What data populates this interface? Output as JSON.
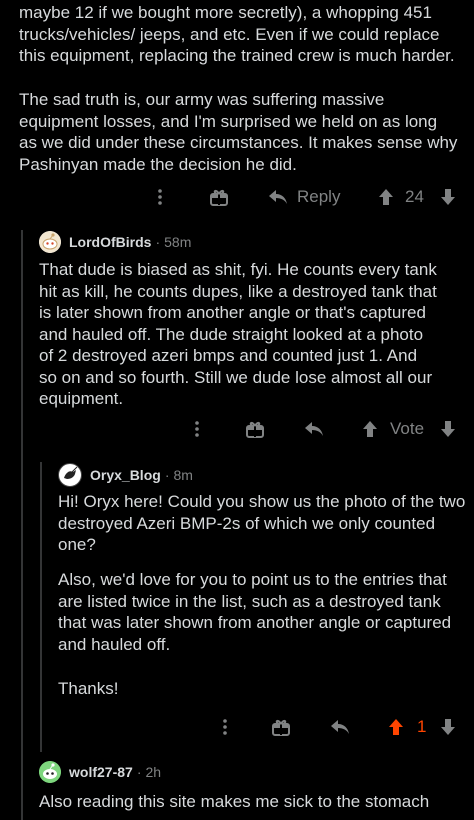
{
  "comments": [
    {
      "body_p1": "maybe 12 if we bought more secretly), a whopping 451\ntrucks/vehicles/ jeeps, and etc. Even if we could replace\nthis equipment, replacing the trained crew is much harder.",
      "body_p2": "The sad truth is, our army was suffering massive\nequipment losses, and I'm surprised we held on as long\nas we did under these circumstances. It makes sense why\nPashinyan made the decision he did.",
      "reply_label": "Reply",
      "score": "24"
    },
    {
      "author": "LordOfBirds",
      "time": "58m",
      "body": "That dude is biased as shit, fyi. He counts every tank\nhit as kill, he counts dupes, like a destroyed tank that\nis later shown from another angle or that's captured\nand hauled off. The dude straight looked at a photo\nof 2 destroyed azeri bmps and counted just 1. And\nso on and so fourth. Still we dude lose almost all our\nequipment.",
      "vote_label": "Vote"
    },
    {
      "author": "Oryx_Blog",
      "time": "8m",
      "body_p1": "Hi! Oryx here! Could you show us the photo of the two\ndestroyed Azeri BMP-2s of which we only counted\none?",
      "body_p2": "Also, we'd love for you to point us to the entries that\nare listed twice in the list, such as a destroyed tank\nthat was later shown from another angle or captured\nand hauled off.",
      "body_p3": "Thanks!",
      "score": "1",
      "score_color": "#ff4500"
    },
    {
      "author": "wolf27-87",
      "time": "2h",
      "body": "Also reading this site makes me sick to the stomach"
    }
  ],
  "separator": "·",
  "icons": [
    "more-vertical-icon",
    "award-icon",
    "reply-arrow-icon",
    "upvote-icon",
    "downvote-icon",
    "snoo-avatar-icon",
    "oryx-avatar-icon"
  ]
}
